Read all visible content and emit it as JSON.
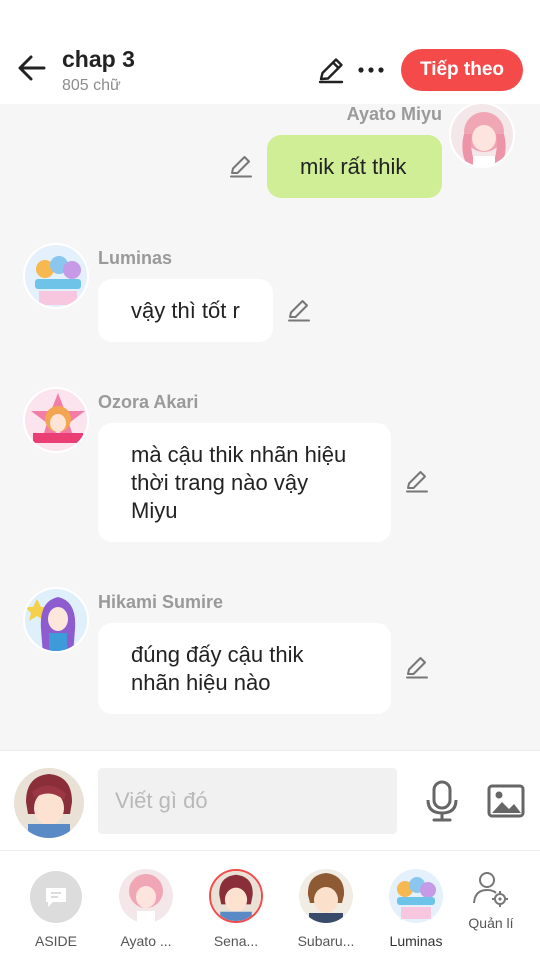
{
  "header": {
    "title": "chap 3",
    "word_count": "805 chữ",
    "next_label": "Tiếp theo",
    "accent": "#f44a4a"
  },
  "messages": [
    {
      "sender": "Ayato  Miyu",
      "text": "mik rất thik",
      "direction": "out"
    },
    {
      "sender": "Luminas",
      "text": "vậy thì tốt r",
      "direction": "in"
    },
    {
      "sender": "Ozora Akari",
      "text": "mà cậu thik nhãn hiệu thời trang nào vậy Miyu",
      "direction": "in"
    },
    {
      "sender": "Hikami Sumire",
      "text": "đúng đấy cậu thik nhãn hiệu nào",
      "direction": "in"
    }
  ],
  "composer": {
    "placeholder": "Viết gì đó",
    "mic_icon": "microphone-icon",
    "image_icon": "image-icon"
  },
  "characters": [
    {
      "label": "ASIDE",
      "icon": "chat-bubble-icon"
    },
    {
      "label": "Ayato ..."
    },
    {
      "label": "Sena..."
    },
    {
      "label": "Subaru..."
    },
    {
      "label": "Luminas"
    },
    {
      "label": "Quản lí",
      "icon": "user-settings-icon"
    }
  ],
  "colors": {
    "outgoing_bubble": "#cfee96",
    "incoming_bubble": "#ffffff",
    "background": "#f6f6f6"
  }
}
